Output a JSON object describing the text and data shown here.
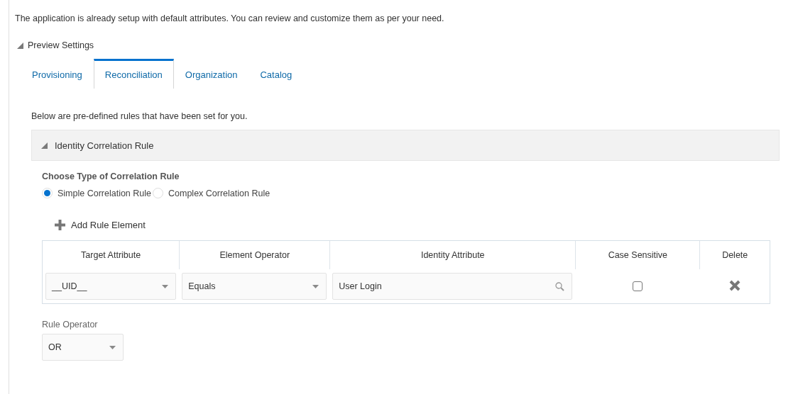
{
  "intro": "The application is already setup with default attributes. You can review and customize them as per your need.",
  "preview": {
    "label": "Preview Settings",
    "expanded": true
  },
  "tabs": [
    {
      "label": "Provisioning",
      "selected": false
    },
    {
      "label": "Reconciliation",
      "selected": true
    },
    {
      "label": "Organization",
      "selected": false
    },
    {
      "label": "Catalog",
      "selected": false
    }
  ],
  "note": "Below are pre-defined rules that have been set for you.",
  "section": {
    "title": "Identity Correlation Rule",
    "expanded": true
  },
  "rule_type": {
    "label": "Choose Type of Correlation Rule",
    "options": [
      {
        "label": "Simple Correlation Rule",
        "selected": true
      },
      {
        "label": "Complex Correlation Rule",
        "selected": false
      }
    ]
  },
  "add_button": "Add Rule Element",
  "table": {
    "columns": [
      "Target Attribute",
      "Element Operator",
      "Identity Attribute",
      "Case Sensitive",
      "Delete"
    ],
    "rows": [
      {
        "target": "__UID__",
        "operator": "Equals",
        "identity": "User Login",
        "case_sensitive": false
      }
    ]
  },
  "rule_operator": {
    "label": "Rule Operator",
    "value": "OR"
  }
}
